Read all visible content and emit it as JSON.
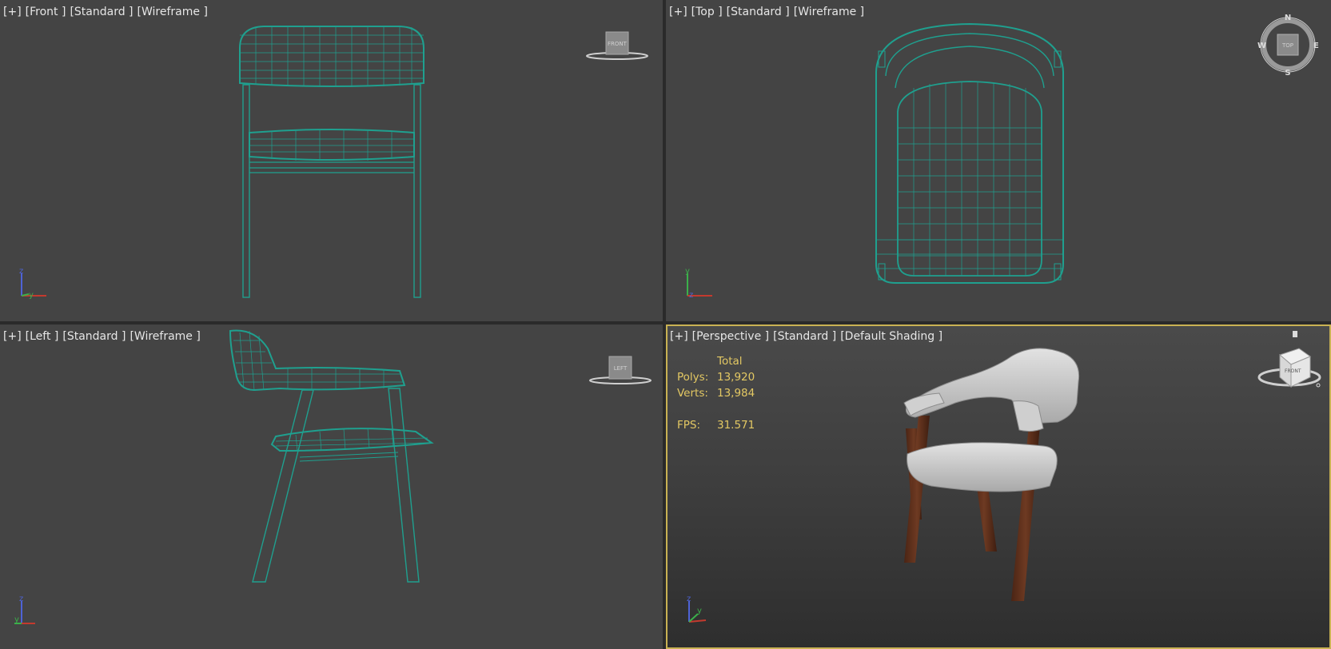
{
  "viewports": {
    "front": {
      "labels": [
        "[+]",
        "[Front ]",
        "[Standard ]",
        "[Wireframe ]"
      ],
      "viewcube_label": "FRONT"
    },
    "top": {
      "labels": [
        "[+]",
        "[Top ]",
        "[Standard ]",
        "[Wireframe ]"
      ],
      "viewcube_label": "TOP",
      "compass": {
        "n": "N",
        "s": "S",
        "e": "E",
        "w": "W"
      }
    },
    "left": {
      "labels": [
        "[+]",
        "[Left ]",
        "[Standard ]",
        "[Wireframe ]"
      ],
      "viewcube_label": "LEFT"
    },
    "perspective": {
      "labels": [
        "[+]",
        "[Perspective ]",
        "[Standard ]",
        "[Default Shading ]"
      ],
      "viewcube_label": "FRONT",
      "stats": {
        "header": "Total",
        "polys_label": "Polys:",
        "polys_value": "13,920",
        "verts_label": "Verts:",
        "verts_value": "13,984",
        "fps_label": "FPS:",
        "fps_value": "31.571"
      },
      "active": true
    }
  },
  "axes": {
    "x": "x",
    "y": "y",
    "z": "z"
  },
  "colors": {
    "wireframe": "#1fa08f",
    "viewport_bg": "#444444",
    "active_border": "#c9b253",
    "stats_text": "#e3c863",
    "label_text": "#e6e6e6",
    "chair_fabric": "#c8c8c8",
    "chair_wood": "#5a2e1c"
  }
}
